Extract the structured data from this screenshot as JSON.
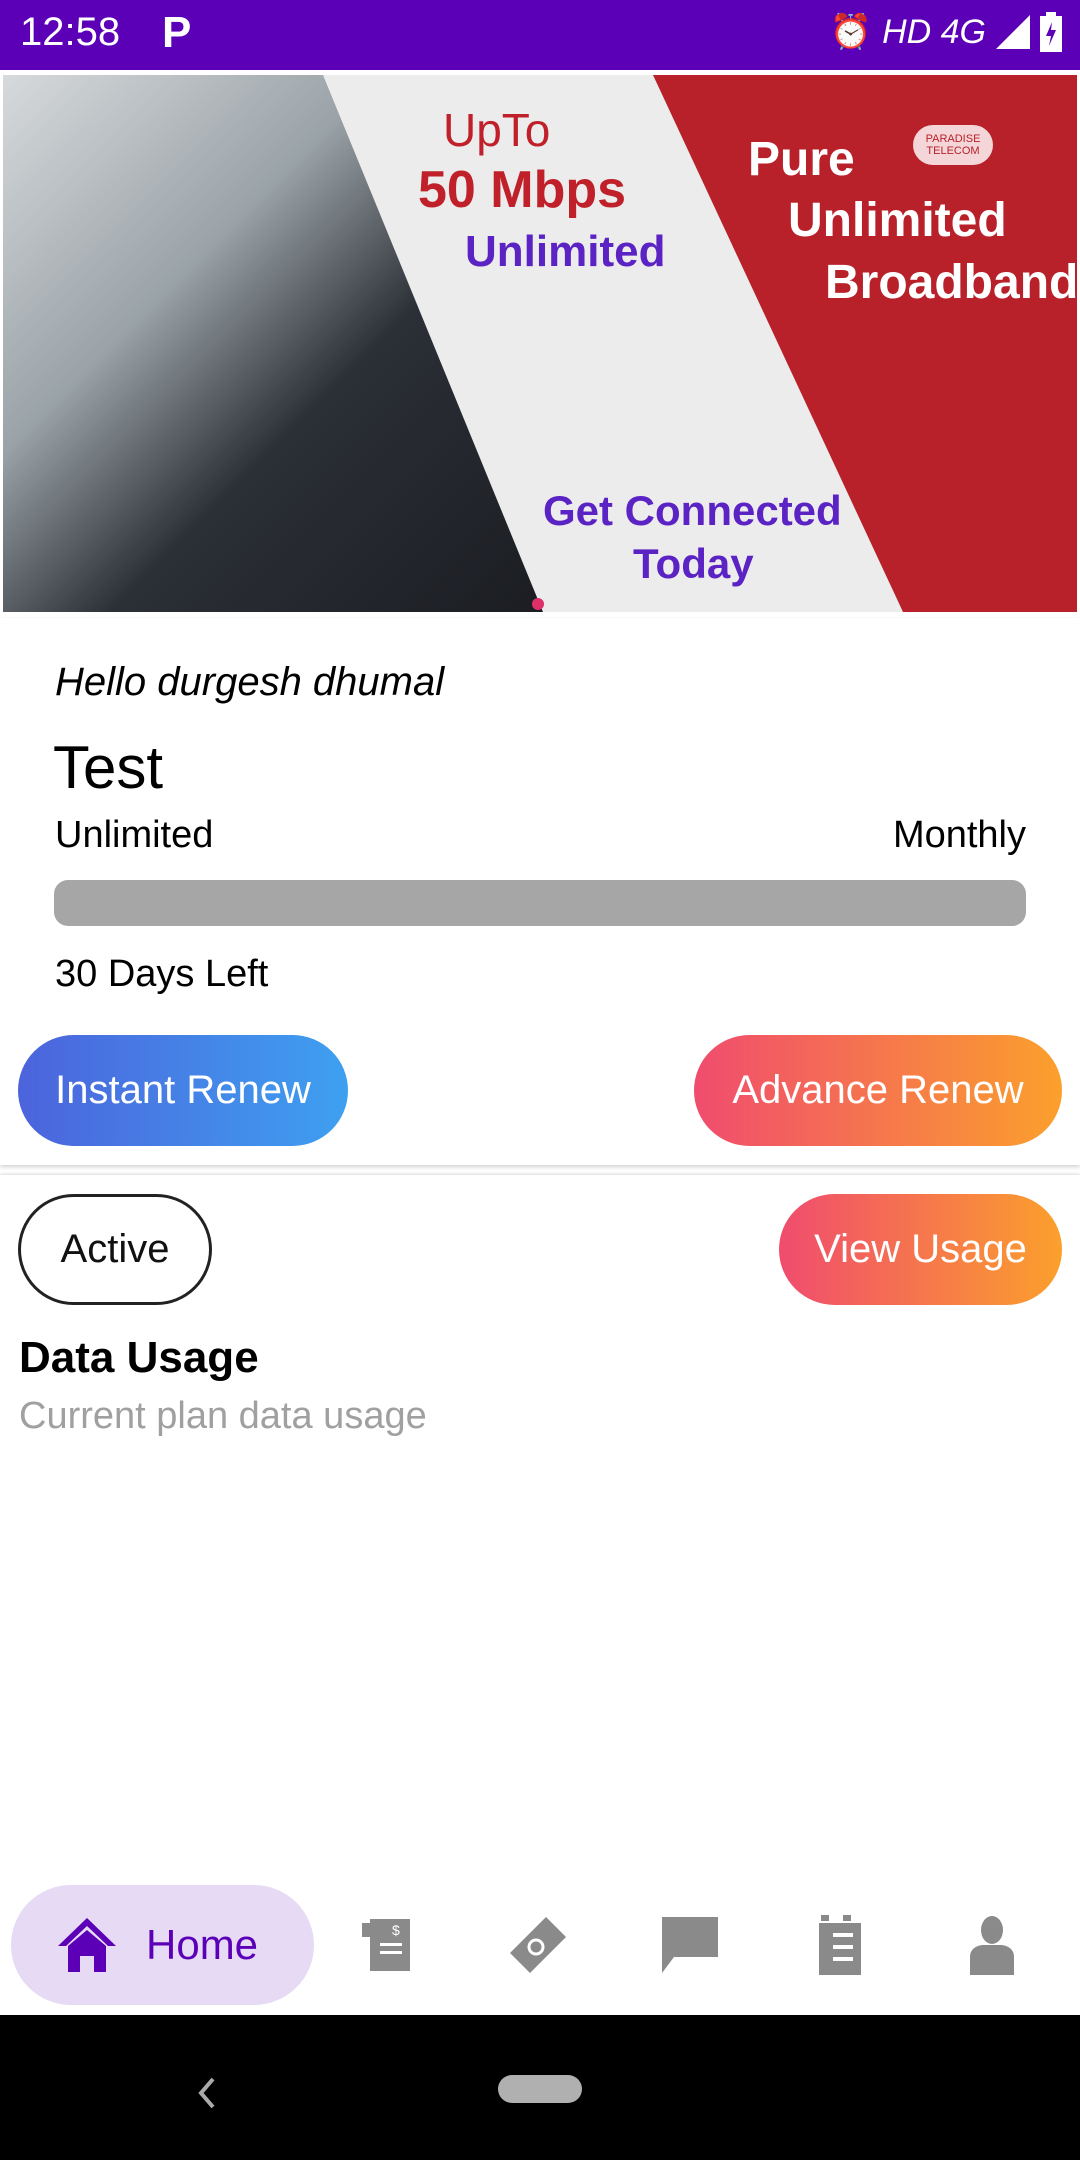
{
  "status_bar": {
    "time": "12:58",
    "app_icon": "P",
    "network": "HD 4G",
    "icons": [
      "alarm-icon",
      "signal-icon",
      "battery-charging-icon"
    ]
  },
  "banner": {
    "line1": "UpTo",
    "line2": "50 Mbps",
    "line3": "Unlimited",
    "right1": "Pure",
    "right2": "Unlimited",
    "right3": "Broadband",
    "cta1": "Get Connected",
    "cta2": "Today",
    "logo": "PARADISE TELECOM"
  },
  "plan": {
    "greeting": "Hello durgesh dhumal",
    "name": "Test",
    "data": "Unlimited",
    "period": "Monthly",
    "progress": 1.0,
    "days_left": "30 Days Left",
    "instant_renew": "Instant Renew",
    "advance_renew": "Advance Renew"
  },
  "usage": {
    "status": "Active",
    "view_usage": "View Usage",
    "title": "Data Usage",
    "subtitle": "Current plan data usage"
  },
  "nav": {
    "home": "Home",
    "items": [
      "home-icon",
      "bill-icon",
      "ticket-icon",
      "chat-icon",
      "checklist-icon",
      "profile-icon"
    ]
  },
  "colors": {
    "primary": "#5c00b8",
    "progress": "#a6a6a6",
    "nav_active_bg": "#e6daf4",
    "inactive_icon": "#8a8a8a"
  }
}
